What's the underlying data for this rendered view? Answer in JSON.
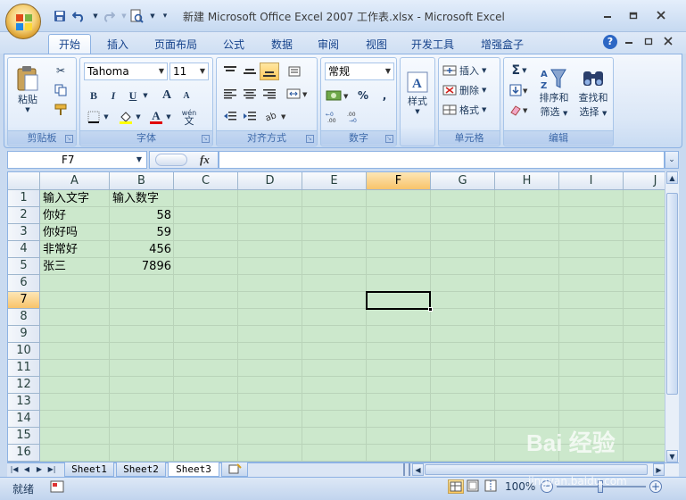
{
  "window": {
    "title": "新建 Microsoft Office Excel 2007 工作表.xlsx - Microsoft Excel"
  },
  "tabs": [
    "开始",
    "插入",
    "页面布局",
    "公式",
    "数据",
    "审阅",
    "视图",
    "开发工具",
    "增强盒子"
  ],
  "ribbon": {
    "clipboard": {
      "label": "剪贴板",
      "paste": "粘贴"
    },
    "font": {
      "label": "字体",
      "name": "Tahoma",
      "size": "11",
      "bold": "B",
      "italic": "I",
      "underline": "U",
      "grow": "A",
      "shrink": "A",
      "color_a": "A",
      "phonetic": "wén"
    },
    "alignment": {
      "label": "对齐方式"
    },
    "number": {
      "label": "数字",
      "format": "常规",
      "percent": "%",
      "comma": ","
    },
    "styles": {
      "label": "样式"
    },
    "cells": {
      "label": "单元格",
      "insert": "插入",
      "delete": "删除",
      "format": "格式"
    },
    "editing": {
      "label": "编辑",
      "sort_filter_1": "排序和",
      "sort_filter_2": "筛选",
      "find_select_1": "查找和",
      "find_select_2": "选择",
      "sigma": "Σ"
    }
  },
  "formula_bar": {
    "name_box": "F7",
    "fx": "fx",
    "content": ""
  },
  "columns": [
    "A",
    "B",
    "C",
    "D",
    "E",
    "F",
    "G",
    "H",
    "I",
    "J"
  ],
  "selected_column": "F",
  "rows": [
    "1",
    "2",
    "3",
    "4",
    "5",
    "6",
    "7",
    "8",
    "9",
    "10",
    "11",
    "12",
    "13",
    "14",
    "15",
    "16"
  ],
  "selected_row": "7",
  "cells": {
    "A1": "输入文字",
    "B1": "输入数字",
    "A2": "你好",
    "B2": "58",
    "A3": "你好吗",
    "B3": "59",
    "A4": "非常好",
    "B4": "456",
    "A5": "张三",
    "B5": "7896"
  },
  "sheets": [
    "Sheet1",
    "Sheet2",
    "Sheet3"
  ],
  "active_sheet": "Sheet3",
  "status": {
    "ready": "就绪",
    "zoom": "100%"
  },
  "watermark": {
    "text": "Bai 经验",
    "sub": "jingyan.baidu.com"
  }
}
